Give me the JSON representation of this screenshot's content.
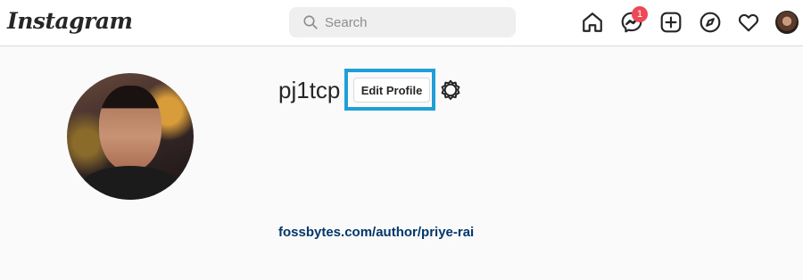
{
  "header": {
    "logo_text": "Instagram",
    "search": {
      "placeholder": "Search",
      "value": ""
    },
    "nav_icons": [
      "home-icon",
      "messenger-icon",
      "new-post-icon",
      "explore-icon",
      "activity-heart-icon",
      "profile-avatar"
    ],
    "messages_badge": "1"
  },
  "profile": {
    "username": "pj1tcp",
    "edit_button_label": "Edit Profile",
    "settings_icon": "gear-icon",
    "website": "fossbytes.com/author/priye-rai"
  },
  "colors": {
    "background": "#fafafa",
    "highlight_outline": "#1f9ed8",
    "badge": "#ed4956",
    "link": "#00376b"
  }
}
